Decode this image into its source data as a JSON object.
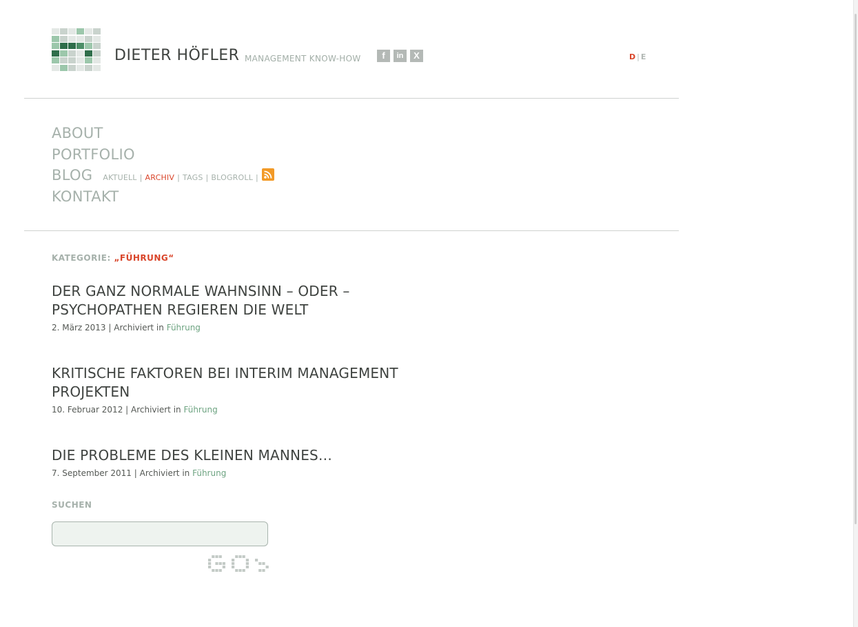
{
  "header": {
    "site_title": "DIETER HÖFLER",
    "tagline": "MANAGEMENT KNOW-HOW",
    "social": [
      {
        "name": "facebook-icon",
        "glyph": "f"
      },
      {
        "name": "linkedin-icon",
        "glyph": "in"
      },
      {
        "name": "xing-icon",
        "glyph": "X"
      }
    ],
    "lang": {
      "de": "D",
      "sep": "|",
      "en": "E"
    },
    "colors": {
      "accent": "#d9452a",
      "green": "#6ea482",
      "muted": "#a6b1ab",
      "text": "#3f4340"
    }
  },
  "nav": {
    "about": "ABOUT",
    "portfolio": "PORTFOLIO",
    "blog": "BLOG",
    "kontakt": "KONTAKT",
    "blog_sub": {
      "aktuell": "AKTUELL",
      "archiv": "ARCHIV",
      "tags": "TAGS",
      "blogroll": "BLOGROLL",
      "sep": "|"
    }
  },
  "main": {
    "category_label": "KATEGORIE:",
    "category_term": "„FÜHRUNG“",
    "posts": [
      {
        "title": "DER GANZ NORMALE WAHNSINN – ODER – PSYCHOPATHEN REGIEREN DIE WELT",
        "date": "2. März 2013",
        "archived": "| Archiviert in",
        "category": "Führung"
      },
      {
        "title": "KRITISCHE FAKTOREN BEI INTERIM MANAGEMENT PROJEKTEN",
        "date": "10. Februar 2012",
        "archived": "| Archiviert in",
        "category": "Führung"
      },
      {
        "title": "DIE PROBLEME DES KLEINEN MANNES…",
        "date": "7. September 2011",
        "archived": "| Archiviert in",
        "category": "Führung"
      }
    ]
  },
  "search": {
    "label": "SUCHEN",
    "value": "",
    "placeholder": "",
    "button": "GO >"
  }
}
